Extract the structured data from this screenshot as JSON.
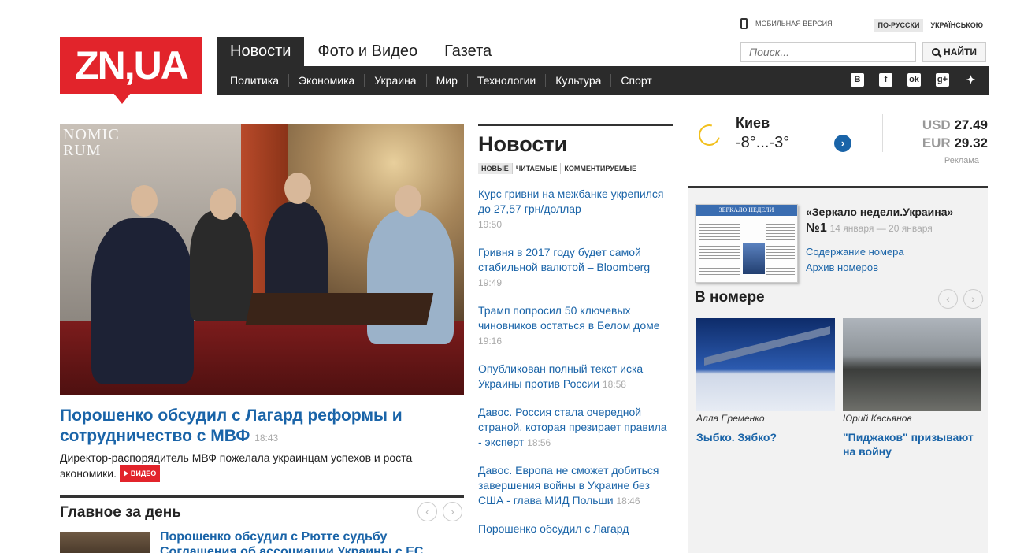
{
  "topbar": {
    "mobile_label": "Мобильная версия",
    "lang_ru": "По-русски",
    "lang_ua": "Українською"
  },
  "logo": {
    "text": "ZN,UA",
    "color": "#e2242b"
  },
  "nav": {
    "tabs": [
      {
        "label": "Новости",
        "active": true
      },
      {
        "label": "Фото и Видео",
        "active": false
      },
      {
        "label": "Газета",
        "active": false
      }
    ],
    "subitems": [
      "Политика",
      "Экономика",
      "Украина",
      "Мир",
      "Технологии",
      "Культура",
      "Спорт"
    ],
    "social": [
      "vk-icon",
      "facebook-icon",
      "odnoklassniki-icon",
      "google-plus-icon",
      "twitter-icon"
    ]
  },
  "search": {
    "placeholder": "Поиск...",
    "button_label": "Найти"
  },
  "hero": {
    "image_text": "NOMIC\nRUM",
    "title": "Порошенко обсудил с Лагард реформы и сотрудничество с МВФ",
    "time": "18:43",
    "lead": "Директор-распорядитель МВФ пожелала украинцам успехов и роста экономики.",
    "video_label": "Видео"
  },
  "main_day": {
    "heading": "Главное за день",
    "item_title": "Порошенко обсудил с Рютте судьбу Соглашения об ассоциации Украины с ЕС"
  },
  "news": {
    "heading": "Новости",
    "tabs": [
      "Новые",
      "Читаемые",
      "Комментируемые"
    ],
    "items": [
      {
        "title": "Курс гривни на межбанке укрепился до 27,57 грн/доллар",
        "time": "19:50"
      },
      {
        "title": "Гривня в 2017 году будет самой стабильной валютой – Bloomberg",
        "time": "19:49"
      },
      {
        "title": "Трамп попросил 50 ключевых чиновников остаться в Белом доме",
        "time": "19:16"
      },
      {
        "title": "Опубликован полный текст иска Украины против России",
        "time": "18:58"
      },
      {
        "title": "Давос. Россия стала очередной страной, которая презирает правила - эксперт",
        "time": "18:56"
      },
      {
        "title": "Давос. Европа не сможет добиться завершения войны в Украине без США - глава МИД Польши",
        "time": "18:46"
      },
      {
        "title": "Порошенко обсудил с Лагард",
        "time": ""
      }
    ]
  },
  "weather": {
    "city": "Киев",
    "temp": "-8°...-3°"
  },
  "rates": {
    "usd_label": "USD",
    "usd_value": "27.49",
    "eur_label": "EUR",
    "eur_value": "29.32",
    "ad_label": "Реклама"
  },
  "newspaper": {
    "masthead": "ЗЕРКАЛО НЕДЕЛИ",
    "title": "«Зеркало недели.Украина»",
    "number": "№1",
    "dates": "14 января — 20 января",
    "links": [
      "Содержание номера",
      "Архив номеров"
    ],
    "in_issue_heading": "В номере",
    "issues": [
      {
        "author": "Алла Еременко",
        "title": "Зыбко. Зябко?"
      },
      {
        "author": "Юрий Касьянов",
        "title": "\"Пиджаков\" призывают на войну"
      }
    ]
  }
}
